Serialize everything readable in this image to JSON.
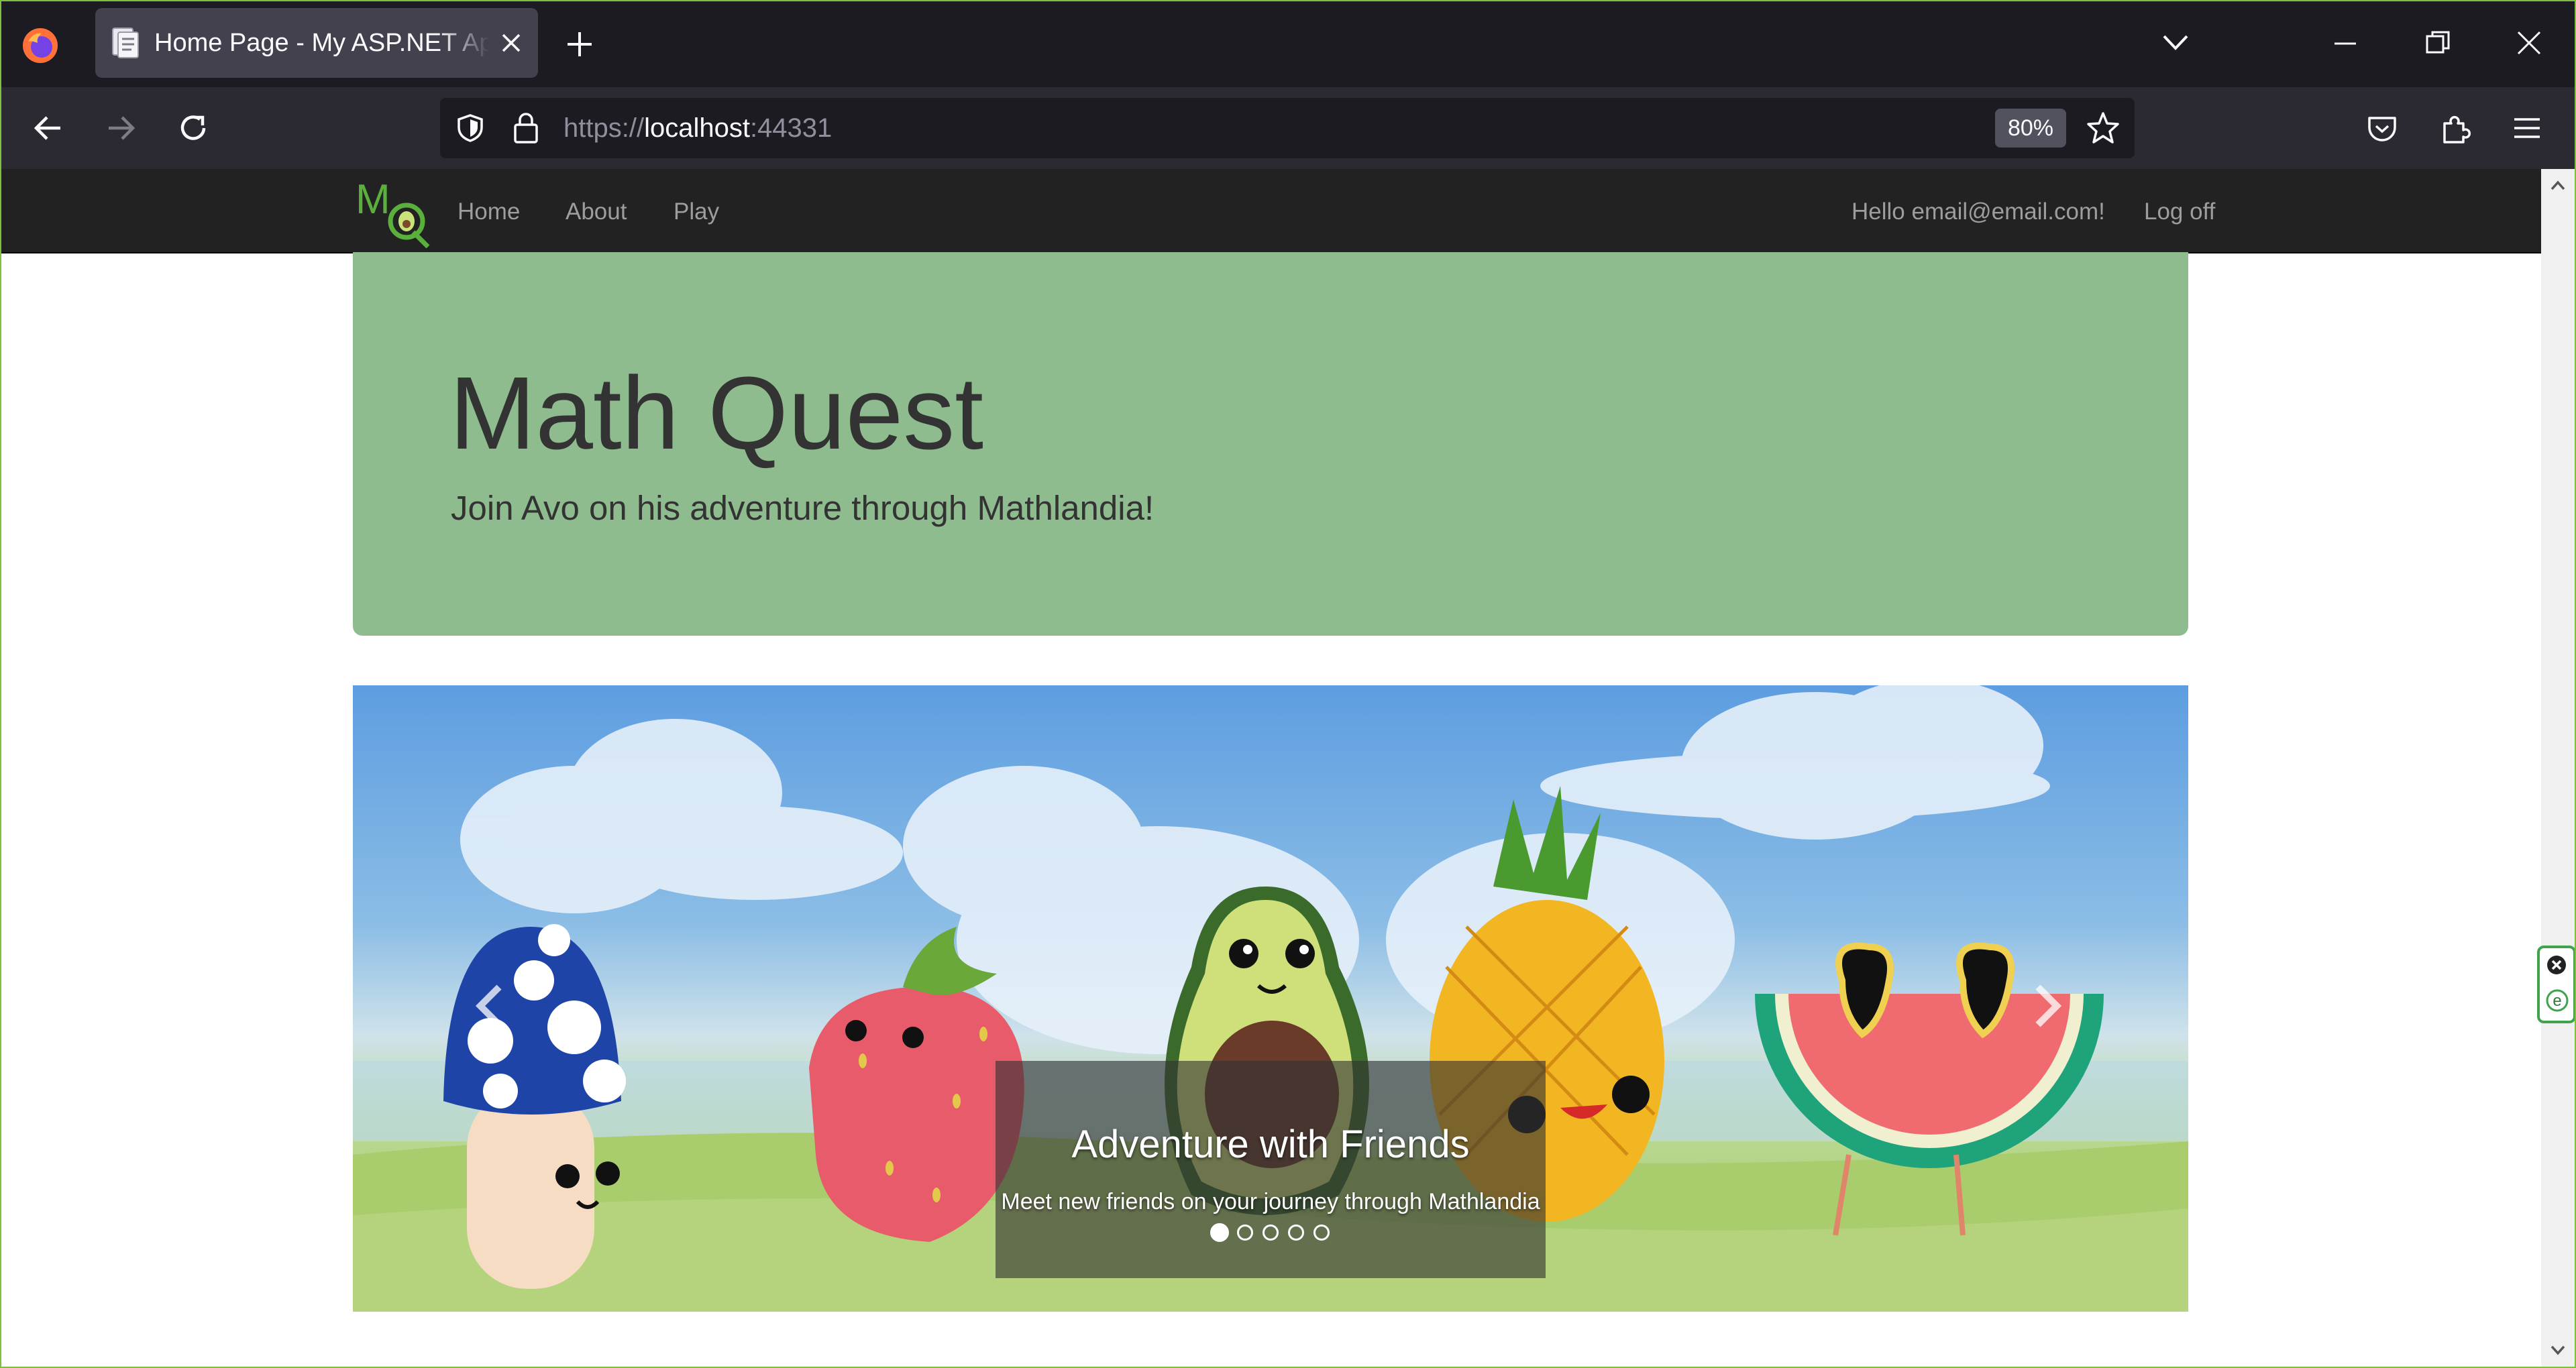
{
  "browser": {
    "tab_title": "Home Page - My ASP.NET Application",
    "url_scheme": "https://",
    "url_host": "localhost",
    "url_port": ":44331",
    "zoom": "80%"
  },
  "site": {
    "nav": {
      "links": [
        "Home",
        "About",
        "Play"
      ],
      "greeting": "Hello email@email.com!",
      "logoff": "Log off"
    },
    "hero": {
      "title": "Math Quest",
      "subtitle": "Join Avo on his adventure through Mathlandia!"
    },
    "carousel": {
      "caption_title": "Adventure with Friends",
      "caption_text": "Meet new friends on your journey through Mathlandia",
      "slide_count": 5,
      "active_slide": 1
    }
  },
  "colors": {
    "accent_green": "#8fbc8f",
    "site_nav_bg": "#222222",
    "browser_bg": "#1c1b22"
  }
}
